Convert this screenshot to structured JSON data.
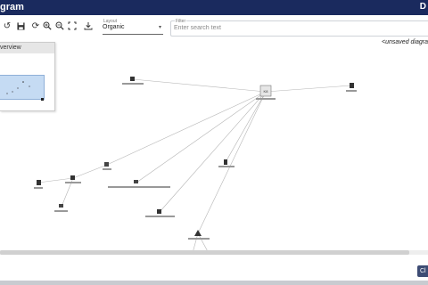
{
  "titlebar": {
    "title": "gram",
    "corner_label": "D"
  },
  "toolbar": {
    "layout_label": "Layout",
    "layout_value": "Organic",
    "filter_label": "Filter",
    "filter_placeholder": "Enter search text"
  },
  "canvas": {
    "status": "<unsaved diagra"
  },
  "overview": {
    "title": "verview"
  },
  "footer": {
    "button_label": "Cl"
  }
}
